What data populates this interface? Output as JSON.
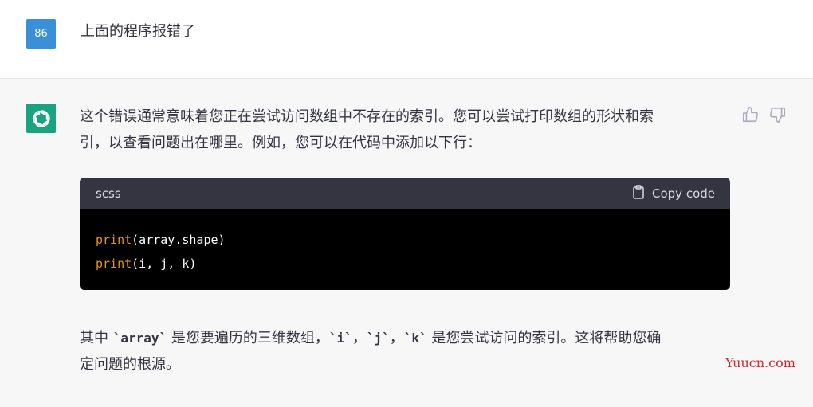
{
  "user_message": {
    "avatar_text": "86",
    "text": "上面的程序报错了"
  },
  "assistant_message": {
    "para1_line1": "这个错误通常意味着您正在尝试访问数组中不存在的索引。您可以尝试打印数组的形状和索",
    "para1_line2": "引，以查看问题出在哪里。例如，您可以在代码中添加以下行：",
    "code_block": {
      "language": "scss",
      "copy_label": "Copy code",
      "lines": [
        {
          "fn": "print",
          "args": "(array.shape)"
        },
        {
          "fn": "print",
          "args": "(i, j, k)"
        }
      ]
    },
    "para2": {
      "t1": "其中 ",
      "c1": "`array`",
      "t2": " 是您要遍历的三维数组，",
      "c2": "`i`",
      "t3": "，",
      "c3": "`j`",
      "t4": "，",
      "c4": "`k`",
      "t5": " 是您尝试访问的索引。这将帮助您确",
      "line2": "定问题的根源。"
    }
  },
  "watermark": "Yuucn.com",
  "icons": {
    "thumbs_up": "thumbs-up-icon",
    "thumbs_down": "thumbs-down-icon",
    "copy": "clipboard-icon",
    "logo": "openai-logo-icon"
  },
  "colors": {
    "user_avatar": "#3b8fd9",
    "bot_logo": "#19a37f",
    "code_keyword": "#e9950c",
    "watermark": "#d22b2b"
  }
}
